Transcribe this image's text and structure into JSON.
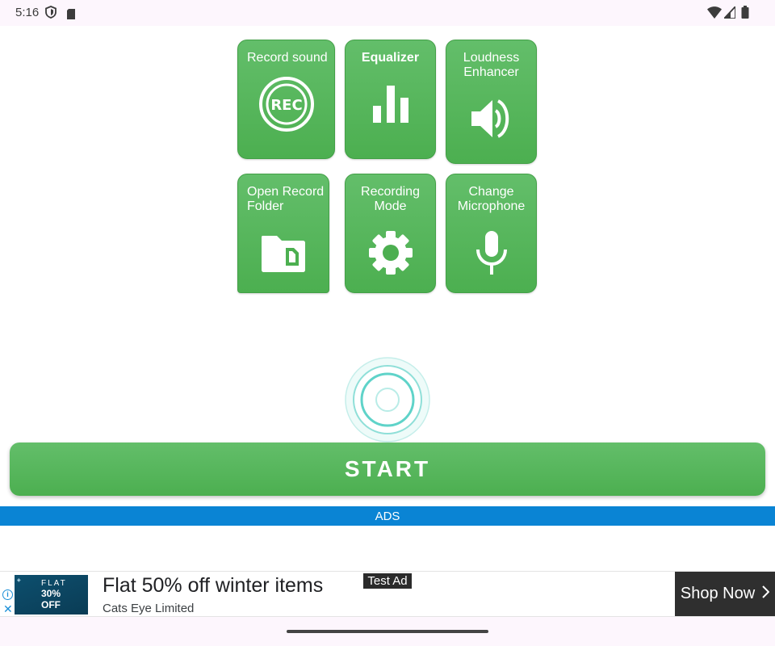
{
  "status_bar": {
    "time": "5:16",
    "left_icons": [
      "shield-icon",
      "sd-card-icon"
    ],
    "right_icons": [
      "wifi-icon",
      "cell-signal-icon",
      "battery-icon"
    ]
  },
  "tiles": [
    {
      "id": "record-sound",
      "label": "Record sound",
      "icon": "rec-icon"
    },
    {
      "id": "equalizer",
      "label": "Equalizer",
      "icon": "equalizer-icon"
    },
    {
      "id": "loudness-enhancer",
      "label": "Loudness\nEnhancer",
      "icon": "speaker-icon"
    },
    {
      "id": "open-record-folder",
      "label": "Open Record\nFolder",
      "icon": "folder-icon"
    },
    {
      "id": "recording-mode",
      "label": "Recording\nMode",
      "icon": "gear-icon"
    },
    {
      "id": "change-microphone",
      "label": "Change\nMicrophone",
      "icon": "microphone-icon"
    }
  ],
  "rec_icon_text": "REC",
  "start_button": {
    "label": "START"
  },
  "ads_bar": {
    "label": "ADS"
  },
  "ad": {
    "image_flat": "FLAT",
    "image_pct": "30%",
    "image_off": "OFF",
    "headline": "Flat 50% off winter items",
    "advertiser": "Cats Eye Limited",
    "badge": "Test Ad",
    "cta": "Shop Now",
    "info_icon": "i",
    "close_icon": "✕"
  },
  "colors": {
    "tile_green": "#4caf50",
    "ads_blue": "#0a84d4",
    "ripple_teal": "#5fd3c9"
  }
}
